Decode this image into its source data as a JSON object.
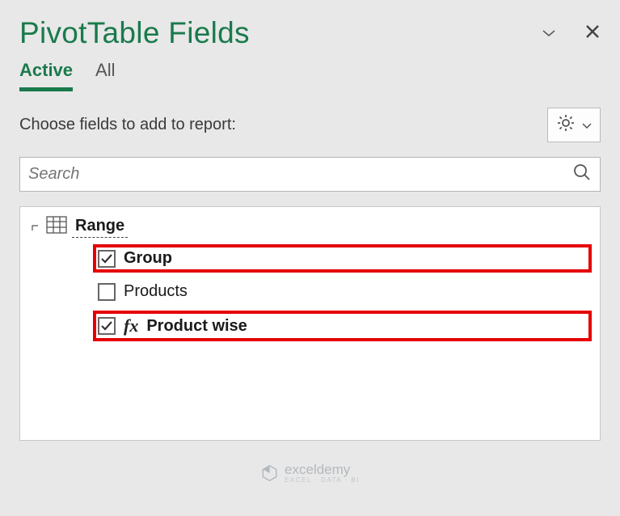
{
  "panel": {
    "title": "PivotTable Fields",
    "tabs": {
      "active": "Active",
      "all": "All"
    },
    "instruction": "Choose fields to add to report:",
    "search_placeholder": "Search"
  },
  "fields": {
    "source_name": "Range",
    "items": [
      {
        "label": "Group",
        "checked": true,
        "bold": true,
        "highlighted": true,
        "fx": false
      },
      {
        "label": "Products",
        "checked": false,
        "bold": false,
        "highlighted": false,
        "fx": false
      },
      {
        "label": "Product wise",
        "checked": true,
        "bold": true,
        "highlighted": true,
        "fx": true
      }
    ]
  },
  "watermark": {
    "brand": "exceldemy",
    "sub": "EXCEL · DATA · BI"
  }
}
